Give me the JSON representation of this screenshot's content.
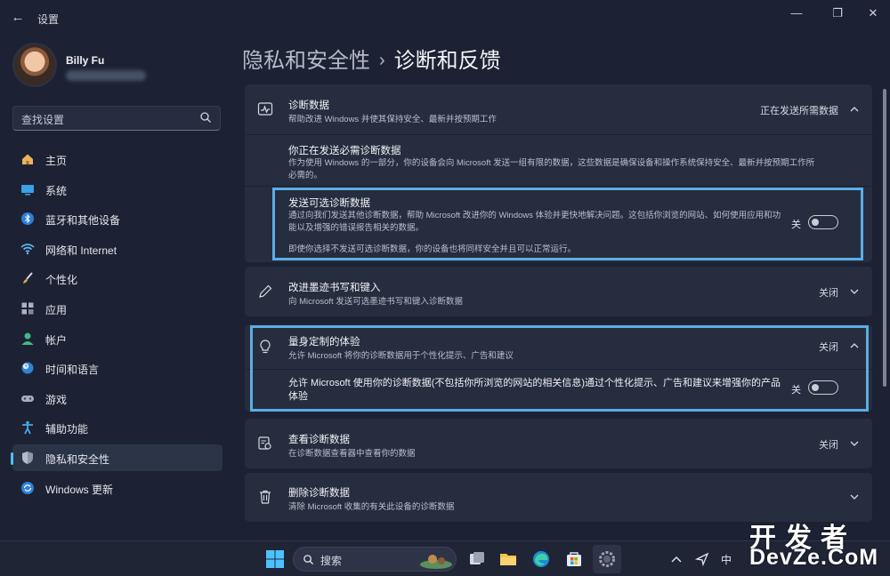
{
  "app": {
    "title": "设置"
  },
  "window_controls": {
    "minimize": "—",
    "maximize": "❐",
    "close": "✕"
  },
  "profile": {
    "name": "Billy Fu"
  },
  "search": {
    "placeholder": "查找设置"
  },
  "sidebar": {
    "items": [
      {
        "label": "主页",
        "icon": "home-icon",
        "active": false
      },
      {
        "label": "系统",
        "icon": "monitor-icon",
        "active": false
      },
      {
        "label": "蓝牙和其他设备",
        "icon": "bluetooth-icon",
        "active": false
      },
      {
        "label": "网络和 Internet",
        "icon": "wifi-icon",
        "active": false
      },
      {
        "label": "个性化",
        "icon": "brush-icon",
        "active": false
      },
      {
        "label": "应用",
        "icon": "apps-icon",
        "active": false
      },
      {
        "label": "帐户",
        "icon": "user-icon",
        "active": false
      },
      {
        "label": "时间和语言",
        "icon": "clock-globe-icon",
        "active": false
      },
      {
        "label": "游戏",
        "icon": "gamepad-icon",
        "active": false
      },
      {
        "label": "辅助功能",
        "icon": "accessibility-icon",
        "active": false
      },
      {
        "label": "隐私和安全性",
        "icon": "shield-icon",
        "active": true
      },
      {
        "label": "Windows 更新",
        "icon": "update-icon",
        "active": false
      }
    ]
  },
  "breadcrumb": {
    "parent": "隐私和安全性",
    "separator": "›",
    "current": "诊断和反馈"
  },
  "diagnostic_data": {
    "title": "诊断数据",
    "desc": "帮助改进 Windows 并使其保持安全、最新并按预期工作",
    "status": "正在发送所需数据",
    "required": {
      "title": "你正在发送必需诊断数据",
      "desc": "作为使用 Windows 的一部分，你的设备会向 Microsoft 发送一组有限的数据，这些数据是确保设备和操作系统保持安全、最新并按预期工作所必需的。"
    },
    "optional": {
      "title": "发送可选诊断数据",
      "desc": "通过向我们发送其他诊断数据，帮助 Microsoft 改进你的 Windows 体验并更快地解决问题。这包括你浏览的网站、如何使用应用和功能以及增强的错误报告相关的数据。",
      "note": "即使你选择不发送可选诊断数据，你的设备也将同样安全并且可以正常运行。",
      "toggle_label": "关",
      "enabled": false
    }
  },
  "inking": {
    "title": "改进墨迹书写和键入",
    "desc": "向 Microsoft 发送可选墨迹书写和键入诊断数据",
    "status": "关闭"
  },
  "tailored": {
    "title": "量身定制的体验",
    "desc": "允许 Microsoft 将你的诊断数据用于个性化提示、广告和建议",
    "status": "关闭",
    "sub_text": "允许 Microsoft 使用你的诊断数据(不包括你所浏览的网站的相关信息)通过个性化提示、广告和建议来增强你的产品体验",
    "toggle_label": "关",
    "enabled": false
  },
  "view_data": {
    "title": "查看诊断数据",
    "desc": "在诊断数据查看器中查看你的数据",
    "status": "关闭"
  },
  "delete_data": {
    "title": "删除诊断数据",
    "desc": "清除 Microsoft 收集的有关此设备的诊断数据"
  },
  "taskbar": {
    "search_text": "搜索",
    "tray_ime": "中"
  },
  "watermark": {
    "line1": "开发者",
    "line2": "DevZe.CoM"
  },
  "colors": {
    "background": "#1c2233",
    "card": "#262d3f",
    "accent": "#4cc2ff",
    "highlight": "#5aaee3"
  }
}
